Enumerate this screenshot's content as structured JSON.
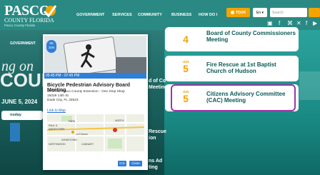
{
  "header": {
    "logo_main": "PASCO",
    "logo_sub": "COUNTY FLORIDA",
    "logo_tag": "Pasco County Florida",
    "nav": [
      "GOVERNMENT",
      "SERVICES",
      "COMMUNITY",
      "BUSINESS",
      "HOW DO I"
    ],
    "tour_label": "TOUR",
    "lang_label": "En ▾",
    "search_placeholder": "Search",
    "icons": [
      "calendar-icon",
      "facebook-icon",
      "share-icon",
      "x-icon",
      "facebook-small-icon",
      "youtube-icon"
    ]
  },
  "background": {
    "gov_label": "GOVERNMENT",
    "big_word_1": "ng on",
    "big_word_2": "COUN",
    "date_line": "JUNE 5, 2024",
    "day_line": "nsday",
    "event_fragments": [
      "d of Co",
      "Meeting",
      "Rescue",
      "ion",
      "ns Ad",
      "ting"
    ]
  },
  "events": [
    {
      "month": "JUN",
      "day": "4",
      "title": "Board of County Commissioners Meeting"
    },
    {
      "month": "JUN",
      "day": "5",
      "title": "Fire Rescue at 1st Baptist Church of Hudson"
    },
    {
      "month": "JUN",
      "day": "5",
      "title": "Citizens Advisory Committee (CAC) Meeting"
    }
  ],
  "modal": {
    "badge_day": "05",
    "badge_month": "JUN",
    "time": "05:45 PM - 07:45 PM",
    "title": "Bicycle Pedestrian Advisory Board Meeting",
    "location_line1": "UF/IFAS Pasco County Extension - One Stop Shop",
    "location_line2": "15029 14th St",
    "location_line3": "Dade City, FL 33523",
    "link": "Link to Map",
    "map_labels": [
      "PARK",
      "PAUL S.",
      "MARKS PARK",
      "La Fortune",
      "DOWNTOWN",
      "NORTH",
      "NORTHWOOD",
      "CANNARY"
    ],
    "ics": "ICS",
    "close": "Close"
  }
}
